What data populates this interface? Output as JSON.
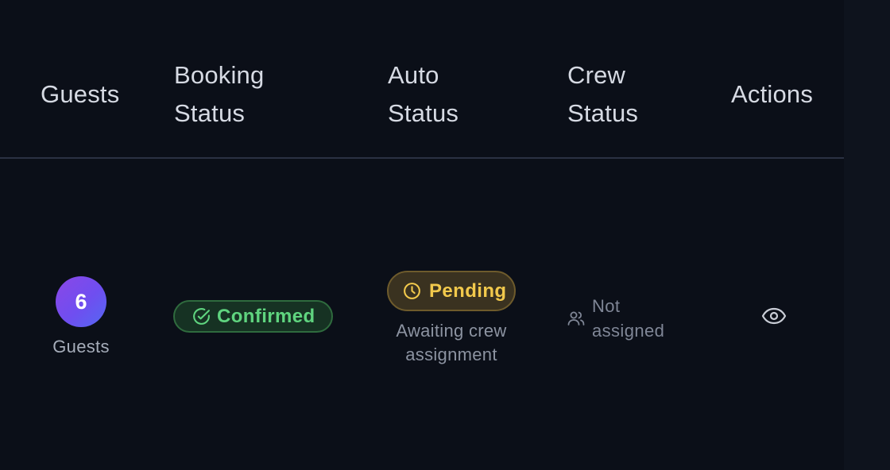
{
  "table": {
    "headers": {
      "guests": "Guests",
      "booking_status": [
        "Booking",
        "Status"
      ],
      "auto_status": [
        "Auto",
        "Status"
      ],
      "crew_status": [
        "Crew",
        "Status"
      ],
      "actions": "Actions"
    }
  },
  "row": {
    "guests": {
      "count": "6",
      "label": "Guests"
    },
    "booking_status": {
      "label": "Confirmed",
      "icon": "check-circle-icon",
      "color": "#5fd47f"
    },
    "auto_status": {
      "label": "Pending",
      "icon": "clock-icon",
      "color": "#f2c94c",
      "note": [
        "Awaiting crew",
        "assignment"
      ]
    },
    "crew_status": {
      "label": [
        "Not",
        "assigned"
      ],
      "icon": "users-icon"
    },
    "actions": {
      "icon": "eye-icon"
    }
  }
}
